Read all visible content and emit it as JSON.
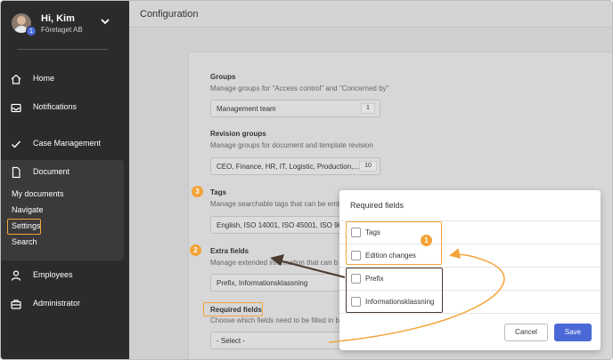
{
  "user": {
    "name": "Hi, Kim",
    "company": "Företaget AB",
    "badge": "1"
  },
  "sidebar": {
    "items": [
      {
        "label": "Home",
        "icon": "home-icon"
      },
      {
        "label": "Notifications",
        "icon": "inbox-icon"
      },
      {
        "label": "Case Management",
        "icon": "check-icon"
      },
      {
        "label": "Document",
        "icon": "document-icon"
      },
      {
        "label": "Employees",
        "icon": "person-icon"
      },
      {
        "label": "Administrator",
        "icon": "briefcase-icon"
      }
    ],
    "document_sub": [
      "My documents",
      "Navigate",
      "Settings",
      "Search"
    ]
  },
  "page_title": "Configuration",
  "sections": {
    "groups": {
      "title": "Groups",
      "desc": "Manage groups for \"Access control\" and \"Concerned by\"",
      "value": "Management team",
      "count": "1"
    },
    "revision": {
      "title": "Revision groups",
      "desc": "Manage groups for document and template revision",
      "value": "CEO, Finance, HR, IT, Logistic, Production,...",
      "count": "10"
    },
    "tags": {
      "title": "Tags",
      "desc": "Manage searchable tags that can be emb",
      "value": "English, ISO 14001, ISO 45001, ISO 900"
    },
    "extra": {
      "title": "Extra fields",
      "desc": "Manage extended information that can b",
      "value": "Prefix, Informationsklassning"
    },
    "required": {
      "title": "Required fields",
      "desc": "Choose which fields need to be filled in b",
      "select": "- Select -"
    }
  },
  "steps": {
    "tags": "3",
    "extra": "2",
    "modal": "1"
  },
  "modal": {
    "title": "Required fields",
    "options": [
      "Tags",
      "Edition changes",
      "Prefix",
      "Informationsklassning"
    ],
    "cancel": "Cancel",
    "save": "Save"
  },
  "colors": {
    "accent": "#f3a33a",
    "primary": "#4a69d6",
    "sidebar": "#2b2b2b",
    "annotation_dark": "#4b3a30"
  }
}
